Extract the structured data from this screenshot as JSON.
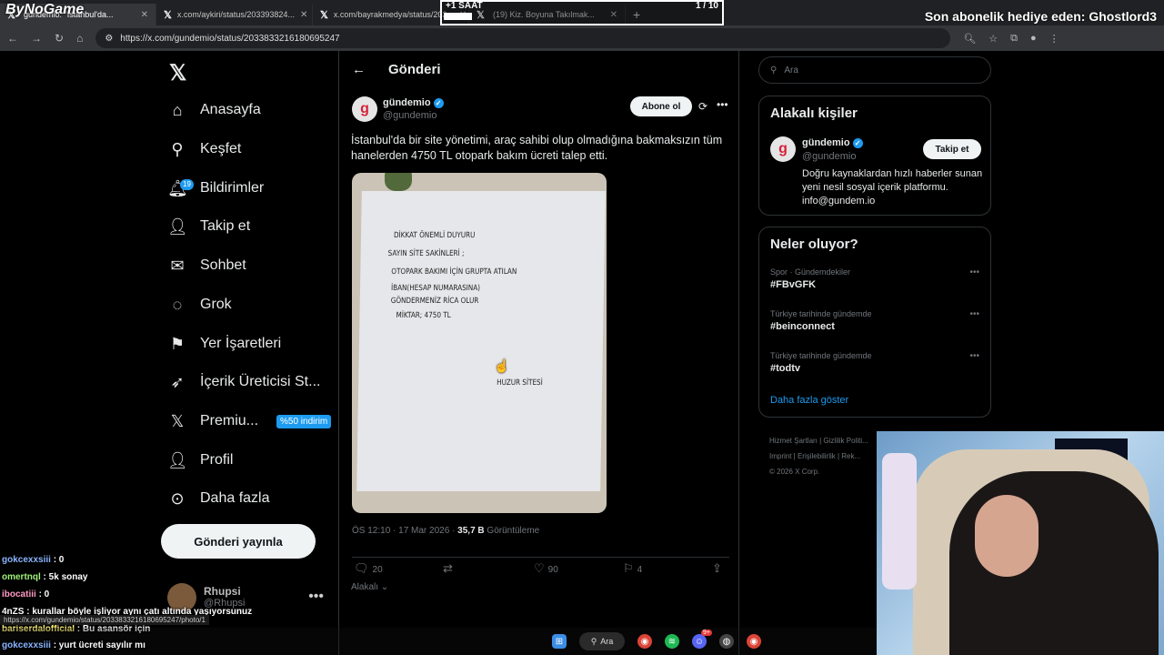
{
  "browser": {
    "tabs": [
      {
        "label": "gundemio: \"İstanbul'da...",
        "fav": "X",
        "active": true
      },
      {
        "label": "x.com/aykiri/status/203393824...",
        "fav": "X",
        "active": false
      },
      {
        "label": "x.com/bayrakmedya/status/203...",
        "fav": "X",
        "active": false
      },
      {
        "label": "(19) Kiz. Boyuna Takılmak...",
        "fav": "X",
        "active": false
      }
    ],
    "url": "https://x.com/gundemio/status/2033833216180695247"
  },
  "overlay": {
    "logo": "ByNoGame",
    "timer_label": "+1 SAAT",
    "timer_count": "1 / 10",
    "timer_progress": 0.1,
    "sub_gift": "Son abonelik hediye eden: Ghostlord3"
  },
  "nav": {
    "items": [
      {
        "label": "Anasayfa",
        "icon": "home-icon"
      },
      {
        "label": "Keşfet",
        "icon": "search-icon"
      },
      {
        "label": "Bildirimler",
        "icon": "bell-icon",
        "badge": "19"
      },
      {
        "label": "Takip et",
        "icon": "person-add-icon"
      },
      {
        "label": "Sohbet",
        "icon": "mail-icon"
      },
      {
        "label": "Grok",
        "icon": "grok-icon"
      },
      {
        "label": "Yer İşaretleri",
        "icon": "bookmark-icon"
      },
      {
        "label": "İçerik Üreticisi St...",
        "icon": "rocket-icon"
      },
      {
        "label": "Premiu...",
        "icon": "x-icon",
        "pill": "%50 indirim"
      },
      {
        "label": "Profil",
        "icon": "profile-icon"
      },
      {
        "label": "Daha fazla",
        "icon": "more-circle-icon"
      }
    ],
    "post_button": "Gönderi yayınla",
    "account": {
      "name": "Rhupsi",
      "handle": "@Rhupsi"
    }
  },
  "post": {
    "header": "Gönderi",
    "author": "gündemio",
    "handle": "@gundemio",
    "subscribe": "Abone ol",
    "text": "İstanbul'da bir site yönetimi, araç sahibi olup olmadığına bakmaksızın tüm hanelerden 4750 TL otopark bakım ücreti talep etti.",
    "image_lines": [
      "DİKKAT ÖNEMLİ DUYURU",
      "SAYIN SİTE SAKİNLERİ ;",
      "OTOPARK BAKIMI İÇİN GRUPTA ATILAN",
      "İBAN(HESAP NUMARASINA)",
      "GÖNDERMENİZ RİCA OLUR",
      "MİKTAR; 4750 TL",
      "HUZUR SİTESİ"
    ],
    "time": "ÖS 12:10 · 17 Mar 2026 · ",
    "views": "35,7 B",
    "views_label": " Görüntüleme",
    "replies": "20",
    "likes": "90",
    "bookmarks": "4",
    "related": "Alakalı ⌄"
  },
  "right": {
    "search_placeholder": "Ara",
    "related_title": "Alakalı kişiler",
    "rel_name": "gündemio",
    "rel_handle": "@gundemio",
    "rel_follow": "Takip et",
    "rel_bio": "Doğru kaynaklardan hızlı haberler sunan yeni nesil sosyal içerik platformu. info@gundem.io",
    "trends_title": "Neler oluyor?",
    "trends": [
      {
        "context": "Spor · Gündemdekiler",
        "tag": "#FBvGFK"
      },
      {
        "context": "Türkiye tarihinde gündemde",
        "tag": "#beinconnect"
      },
      {
        "context": "Türkiye tarihinde gündemde",
        "tag": "#todtv"
      }
    ],
    "show_more": "Daha fazla göster",
    "footer": [
      "Hizmet Şartları | Gizlilik Politi...",
      "Imprint | Erişilebilirlik | Rek...",
      "© 2026 X Corp."
    ]
  },
  "chat": [
    {
      "user": "gokcexxsiii",
      "text": " : 0",
      "cls": "u1"
    },
    {
      "user": "omertnql",
      "text": " : 5k sonay",
      "cls": "u2"
    },
    {
      "user": "ibocatiii",
      "text": " : 0",
      "cls": "u3"
    },
    {
      "user": "4nZS",
      "text": " : kurallar böyle işliyor aynı çatı altında yaşıyorsunuz",
      "cls": "u4"
    },
    {
      "user": "bariserdalofficial",
      "text": " : Bu asansör için",
      "cls": "u5"
    },
    {
      "user": "gokcexxsiii",
      "text": " : yurt ücreti sayılır mı",
      "cls": "u1"
    }
  ],
  "status_url": "https://x.com/gundemio/status/2033833216180695247/photo/1",
  "taskbar": {
    "search": "Ara",
    "notif_badge": "9+"
  }
}
